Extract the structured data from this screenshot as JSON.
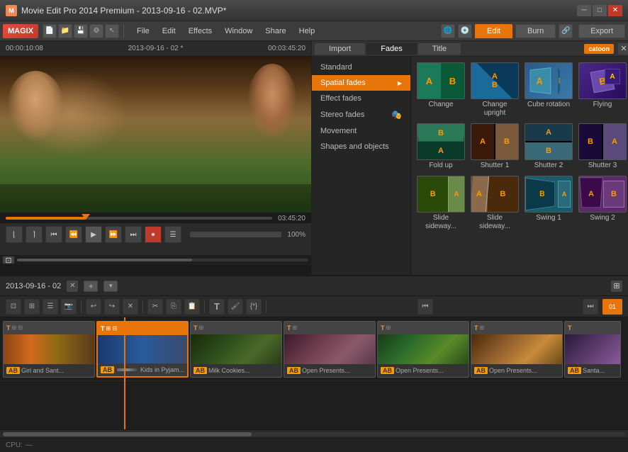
{
  "window": {
    "title": "Movie Edit Pro 2014 Premium - 2013-09-16 - 02.MVP*",
    "controls": [
      "minimize",
      "maximize",
      "close"
    ]
  },
  "menubar": {
    "logo": "MAGIX",
    "menus": [
      "File",
      "Edit",
      "Effects",
      "Window",
      "Share",
      "Help"
    ],
    "tabs": {
      "edit": "Edit",
      "burn": "Burn",
      "export": "Export"
    }
  },
  "preview": {
    "timecode_left": "00:00:10:08",
    "filename": "2013-09-16 - 02 *",
    "timecode_right": "00:03:45:20",
    "progress_time": "03:45:20"
  },
  "effects_panel": {
    "tabs": {
      "import": "Import",
      "fades": "Fades",
      "title": "Title"
    },
    "catoon_badge": "catoon",
    "menu_items": [
      {
        "label": "Standard",
        "has_arrow": false
      },
      {
        "label": "Spatial fades",
        "has_arrow": true
      },
      {
        "label": "Effect fades",
        "has_arrow": false
      },
      {
        "label": "Stereo fades",
        "has_arrow": false
      },
      {
        "label": "Movement",
        "has_arrow": false
      },
      {
        "label": "Shapes and objects",
        "has_arrow": false
      }
    ],
    "effects": {
      "row1": [
        {
          "id": "change",
          "label": "Change"
        },
        {
          "id": "change-upright",
          "label": "Change upright"
        },
        {
          "id": "cube-rotation",
          "label": "Cube rotation"
        },
        {
          "id": "flying",
          "label": "Flying"
        }
      ],
      "row2": [
        {
          "id": "fold-up",
          "label": "Fold up"
        },
        {
          "id": "shutter-1",
          "label": "Shutter 1"
        },
        {
          "id": "shutter-2",
          "label": "Shutter 2"
        },
        {
          "id": "shutter-3",
          "label": "Shutter 3"
        }
      ],
      "row3": [
        {
          "id": "slide-sideway-1",
          "label": "Slide sideway..."
        },
        {
          "id": "slide-sideway-2",
          "label": "Slide sideway..."
        },
        {
          "id": "swing-1",
          "label": "Swing 1"
        },
        {
          "id": "swing-2",
          "label": "Swing 2"
        }
      ]
    }
  },
  "timeline": {
    "project_name": "2013-09-16 - 02",
    "clips": [
      {
        "label": "Girl and Sant...",
        "selected": false
      },
      {
        "label": "Kids in Pyjam...",
        "selected": true
      },
      {
        "label": "Milk Cookies...",
        "selected": false
      },
      {
        "label": "Open Presents...",
        "selected": false
      },
      {
        "label": "Open Presents...",
        "selected": false
      },
      {
        "label": "Open Presents...",
        "selected": false
      },
      {
        "label": "Santa...",
        "selected": false
      }
    ]
  },
  "status": {
    "cpu_label": "CPU:",
    "cpu_value": "—"
  }
}
